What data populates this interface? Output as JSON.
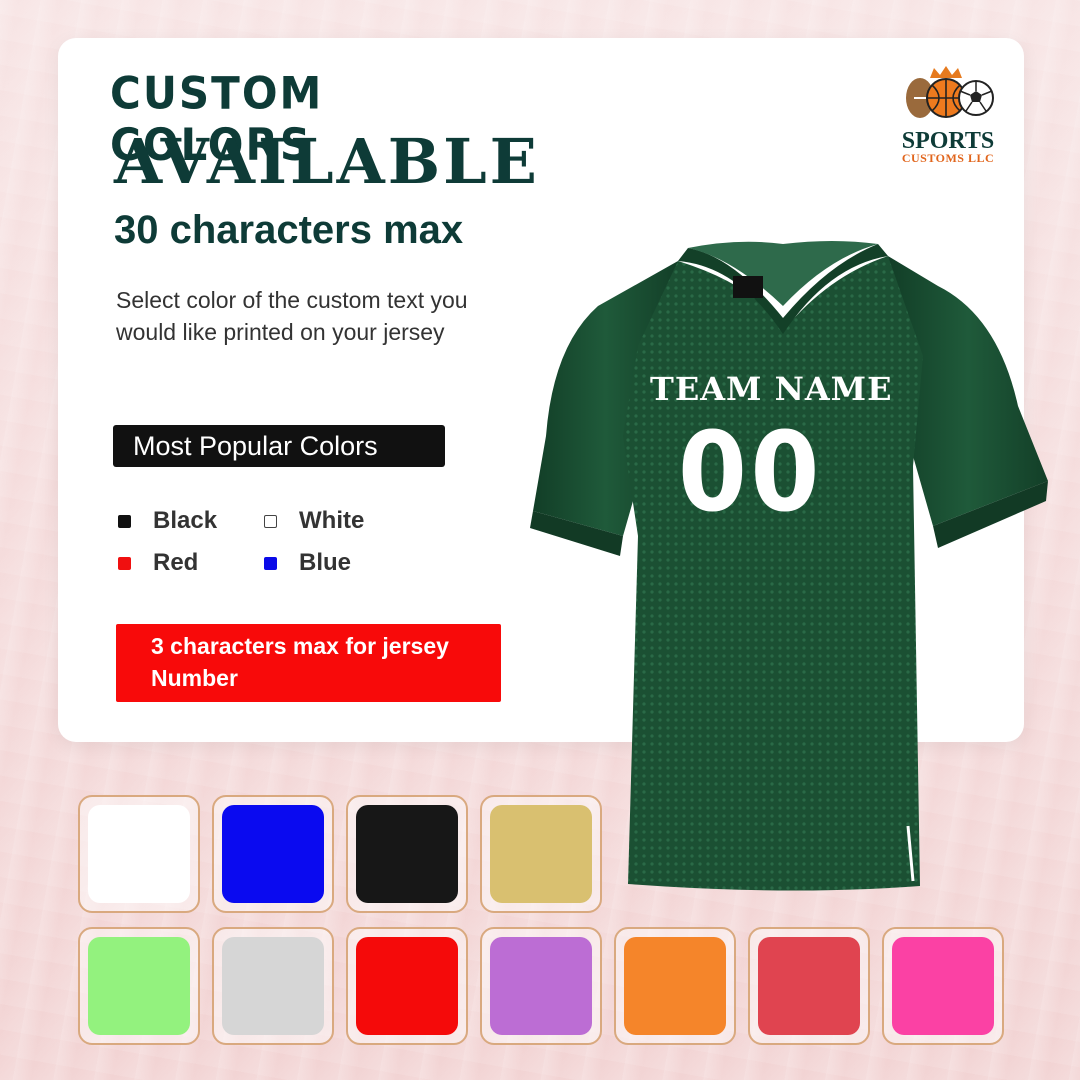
{
  "heading": {
    "line1": "CUSTOM COLORS",
    "line2": "AVAILABLE",
    "line3": "30 characters max"
  },
  "description": "Select color of the custom text you would like printed on your jersey",
  "popular_label": "Most Popular Colors",
  "popular_colors": [
    {
      "label": "Black",
      "color": "#111111"
    },
    {
      "label": "White",
      "color": "#ffffff"
    },
    {
      "label": "Red",
      "color": "#f01010"
    },
    {
      "label": "Blue",
      "color": "#0a0ae8"
    }
  ],
  "note": "3 characters max for jersey Number",
  "logo": {
    "title": "SPORTS",
    "subtitle": "CUSTOMS LLC"
  },
  "jersey": {
    "team_text": "TEAM NAME",
    "number_text": "00",
    "color": "#1b5033"
  },
  "swatches_row1": [
    "#ffffff",
    "#0a0af0",
    "#171717",
    "#d9c070"
  ],
  "swatches_row2": [
    "#93f27e",
    "#d6d6d6",
    "#f50a0a",
    "#bc6dd4",
    "#f5852a",
    "#e04450",
    "#fb41a4"
  ]
}
